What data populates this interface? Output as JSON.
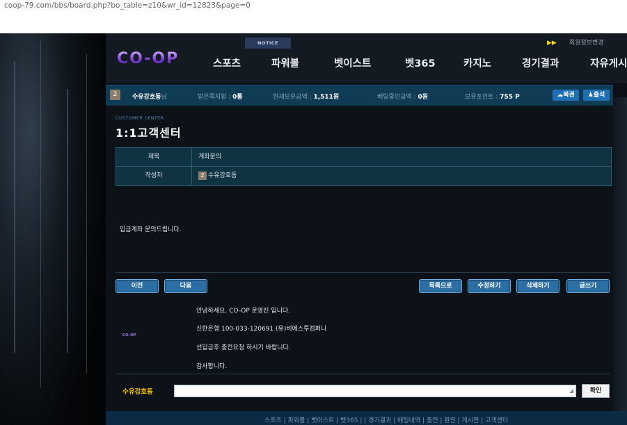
{
  "address_bar": {
    "url": "coop-79.com/bbs/board.php?bo_table=z10&wr_id=12823&page=0"
  },
  "top": {
    "notice_label": "NOTICE",
    "play_icon": "▶▶",
    "right_label": "회원정보변경"
  },
  "brand": {
    "logo_text": "CO-OP"
  },
  "menu": [
    "스포츠",
    "파워볼",
    "벳이스트",
    "벳365",
    "카지노",
    "경기결과",
    "자유게시"
  ],
  "userbar": {
    "level": "2",
    "name": "수유강호동",
    "suffix": "님",
    "received_msgs_label": "받은쪽지함 :",
    "received_msgs_value": "0통",
    "balance_label": "현재보유금액 :",
    "balance_value": "1,511원",
    "betting_label": "베팅중인금액 :",
    "betting_value": "0원",
    "points_label": "보유포인트 :",
    "points_value": "755 P",
    "btn_lottery": "복권",
    "btn_attendance": "출석"
  },
  "page": {
    "section": "CUSTOMER CENTER",
    "title": "1:1고객센터"
  },
  "post": {
    "subject_header": "제목",
    "subject_value": "계좌문의",
    "author_header": "작성자",
    "author_level": "2",
    "author_value": "수유강호동",
    "body": "입금계좌 문의드립니다."
  },
  "actions": {
    "prev": "이전",
    "next": "다음",
    "list": "목록으로",
    "edit": "수정하기",
    "delete": "삭제하기",
    "write": "글쓰기"
  },
  "signature": {
    "logo_text": "CO-OP",
    "line1": "안녕하세요. CO-OP 운영진 입니다.",
    "line2": "신한은행 100-033-120691 (유)비에스투컴퍼니",
    "line3": "선입금후 충전요청 하시기 바랍니다.",
    "line4": "감사합니다."
  },
  "comment": {
    "name": "수유강호동",
    "submit": "확인"
  },
  "footer_links": "스포츠  |  파워볼  |  벳이스트  |  벳365  |    |  경기결과  |  베팅내역  |  충전  |  환전  |  게시판  |  고객센터",
  "colors": {
    "accent_blue": "#1f6fb5",
    "gold": "#f5c400",
    "bar_teal": "#0f3b55"
  }
}
